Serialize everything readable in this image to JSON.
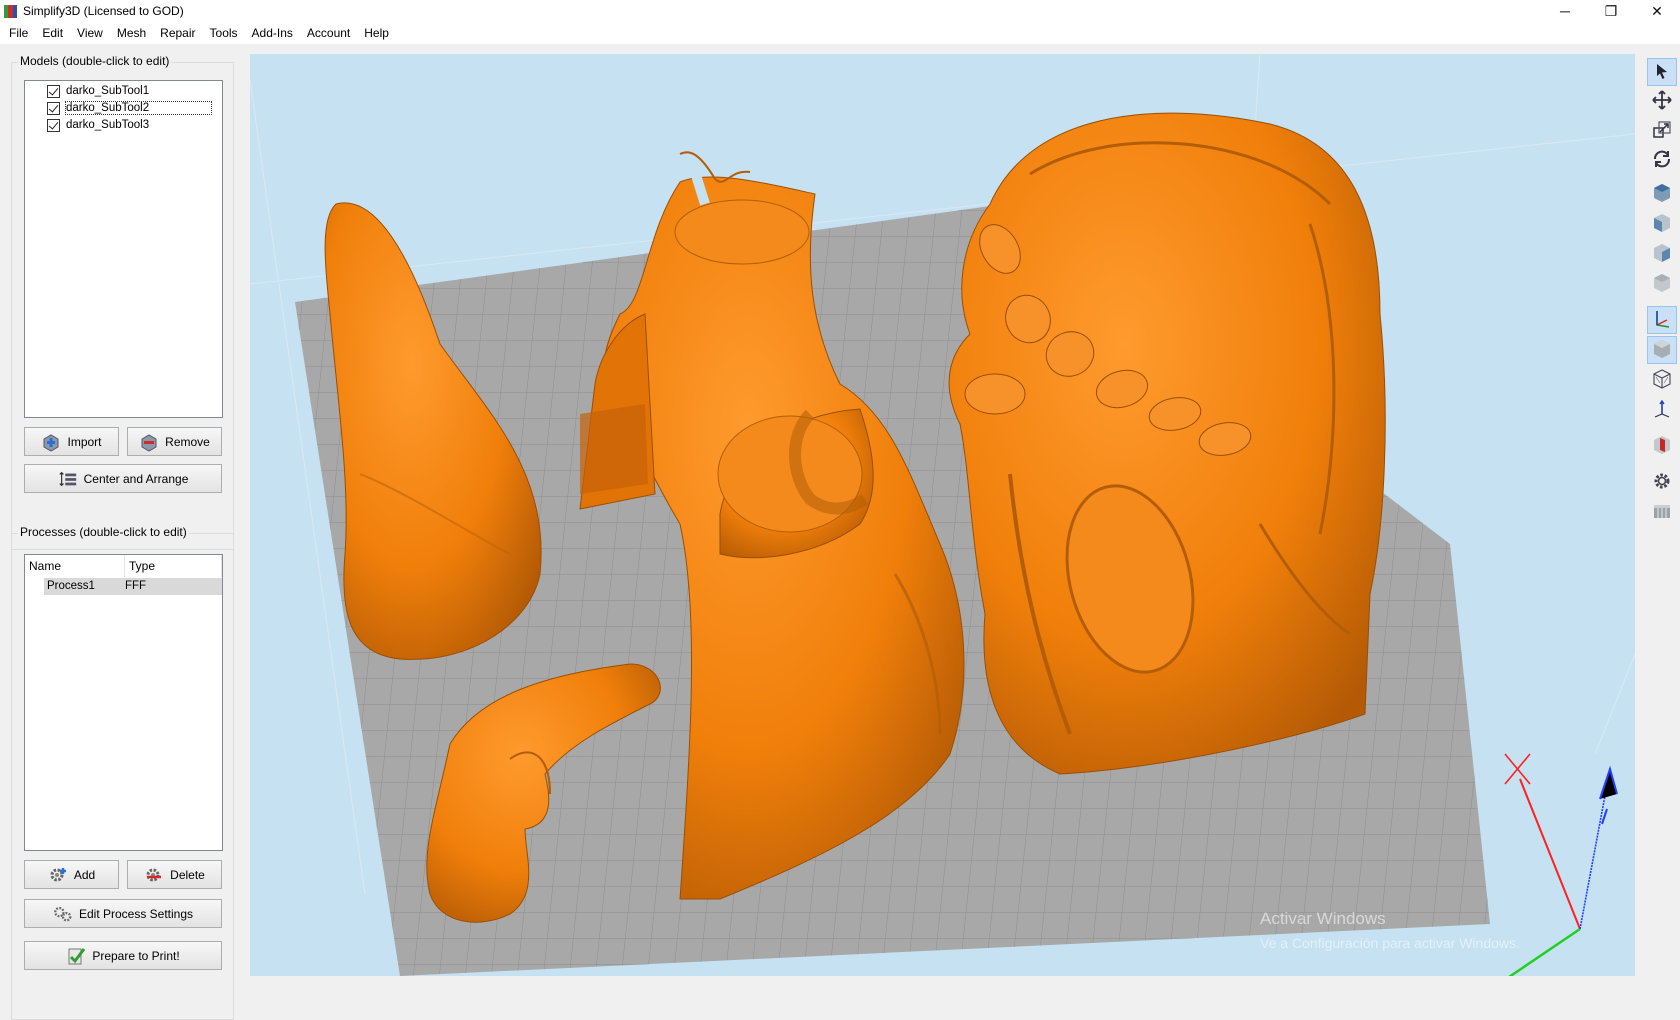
{
  "window": {
    "title": "Simplify3D (Licensed to GOD)",
    "controls": {
      "minimize": "─",
      "restore": "❐",
      "close": "✕"
    }
  },
  "menu": [
    "File",
    "Edit",
    "View",
    "Mesh",
    "Repair",
    "Tools",
    "Add-Ins",
    "Account",
    "Help"
  ],
  "models_panel": {
    "title": "Models (double-click to edit)",
    "items": [
      {
        "label": "darko_SubTool1",
        "checked": true
      },
      {
        "label": "darko_SubTool2",
        "checked": true
      },
      {
        "label": "darko_SubTool3",
        "checked": true
      }
    ],
    "import_label": "Import",
    "remove_label": "Remove",
    "center_label": "Center and Arrange"
  },
  "processes_panel": {
    "title": "Processes (double-click to edit)",
    "columns": [
      "Name",
      "Type"
    ],
    "rows": [
      {
        "name": "Process1",
        "type": "FFF"
      }
    ],
    "add_label": "Add",
    "delete_label": "Delete",
    "edit_label": "Edit Process Settings",
    "prepare_label": "Prepare to Print!"
  },
  "watermark": {
    "line1": "Activar Windows",
    "line2": "Ve a Configuración para activar Windows."
  },
  "toolbar_icons": [
    "select-icon",
    "move-icon",
    "scale-icon",
    "rotate-icon",
    "view-top-icon",
    "view-front-icon",
    "view-left-icon",
    "view-right-icon",
    "axes-toggle-icon",
    "solid-view-icon",
    "wireframe-icon",
    "axis-icon",
    "section-icon",
    "settings-gear-icon",
    "print-bed-icon"
  ],
  "colors": {
    "model": "#f07f0a",
    "bed": "#a8a8a8",
    "sky": "#c5e1f2",
    "x_axis": "#ff2020",
    "y_axis": "#20d020",
    "z_axis": "#2040ff"
  }
}
